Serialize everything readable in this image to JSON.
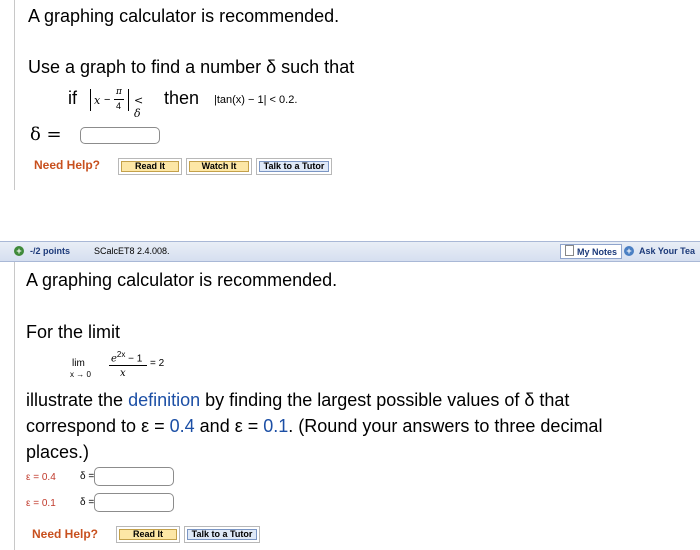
{
  "q1": {
    "recommend": "A graphing calculator is recommended.",
    "prompt": "Use a graph to find a number δ such that",
    "if_word": "if",
    "abs_x": "x",
    "abs_minus": "−",
    "pi": "π",
    "four": "4",
    "lt_delta": "< δ",
    "then_word": "then",
    "tan_expr": "|tan(x) − 1| < 0.2.",
    "delta_eq": "δ =",
    "need_help": "Need Help?",
    "buttons": [
      "Read It",
      "Watch It",
      "Talk to a Tutor"
    ]
  },
  "q2": {
    "points": "-/2 points",
    "code": "SCalcET8 2.4.008.",
    "my_notes": "My Notes",
    "ask_teacher": "Ask Your Tea",
    "recommend": "A graphing calculator is recommended.",
    "for_limit": "For the limit",
    "lim": "lim",
    "lim_sub": "x → 0",
    "numerator": "e",
    "exp": "2x",
    "num_rest": " − 1",
    "denominator": "x",
    "equals_two": "= 2",
    "text1": "illustrate the",
    "definition_link": "definition",
    "text2": "by finding the largest possible values of δ that",
    "text3a": "correspond to ε =",
    "eps1_val": "0.4",
    "text3b": "and ε =",
    "eps2_val": "0.1",
    "text3c": ". (Round your answers to three decimal",
    "text4": "places.)",
    "row1_eps": "ε = 0.4",
    "row1_delta": "δ =",
    "row2_eps": "ε = 0.1",
    "row2_delta": "δ =",
    "need_help": "Need Help?",
    "buttons": [
      "Read It",
      "Talk to a Tutor"
    ]
  },
  "colors": {
    "help": "#c8501e",
    "link": "#1c4fa5",
    "header_bg": "#dfe6f3"
  }
}
